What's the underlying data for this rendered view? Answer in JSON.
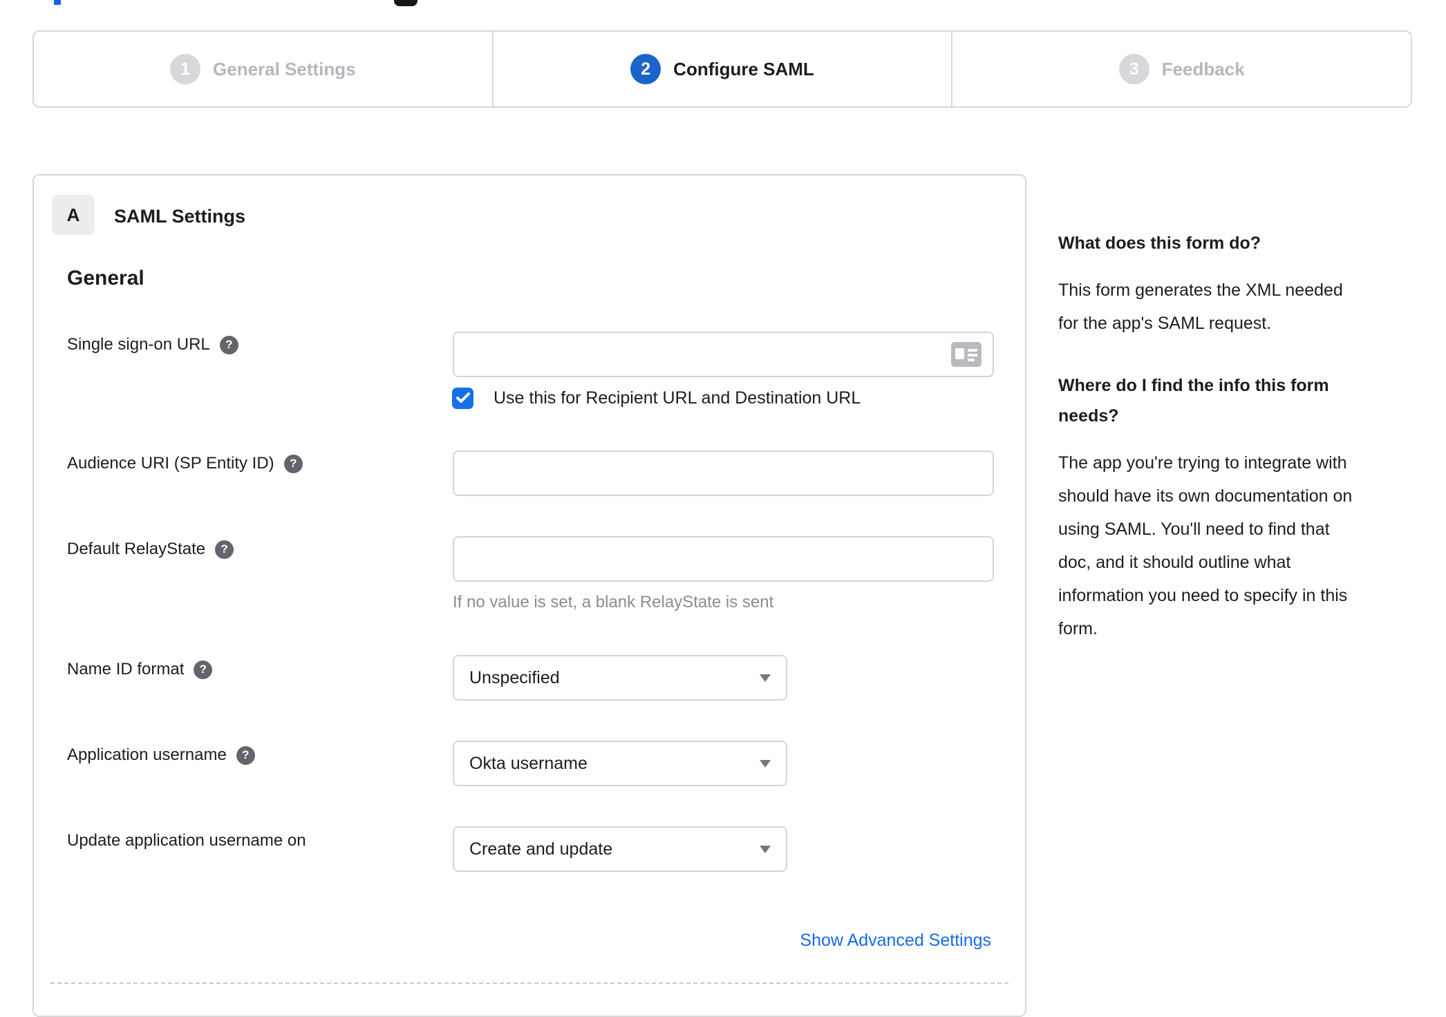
{
  "stepper": {
    "steps": [
      {
        "number": "1",
        "label": "General Settings",
        "active": false
      },
      {
        "number": "2",
        "label": "Configure SAML",
        "active": true
      },
      {
        "number": "3",
        "label": "Feedback",
        "active": false
      }
    ]
  },
  "form": {
    "badge": "A",
    "title": "SAML Settings",
    "section_heading": "General",
    "fields": [
      {
        "label": "Single sign-on URL",
        "value": "",
        "checkbox_label": "Use this for Recipient URL and Destination URL",
        "checkbox_checked": true
      },
      {
        "label": "Audience URI (SP Entity ID)",
        "value": ""
      },
      {
        "label": "Default RelayState",
        "value": "",
        "hint": "If no value is set, a blank RelayState is sent"
      },
      {
        "label": "Name ID format",
        "value": "Unspecified"
      },
      {
        "label": "Application username",
        "value": "Okta username"
      },
      {
        "label": "Update application username on",
        "value": "Create and update"
      }
    ],
    "help_icon_glyph": "?",
    "advanced_link": "Show Advanced Settings"
  },
  "sidebar": {
    "sections": [
      {
        "title_lines": [
          "What does this form do?"
        ],
        "body_lines": [
          "This form generates the XML needed",
          "for the app's SAML request."
        ]
      },
      {
        "title_lines": [
          "Where do I find the info this form",
          "needs?"
        ],
        "body_lines": [
          "The app you're trying to integrate with",
          "should have its own documentation on",
          "using SAML. You'll need to find that",
          "doc, and it should outline what",
          "information you need to specify in this",
          "form."
        ]
      }
    ]
  },
  "colors": {
    "active_step_blue": "#1b64c9",
    "checkbox_blue": "#1570e8",
    "link_blue": "#176be8",
    "border_gray": "#d8d8dd",
    "text_dark": "#1d1d21",
    "muted_text": "#8b8b93",
    "inactive_step_circle": "#d7d7dc",
    "inactive_step_label": "#b6b6bc",
    "badge_bg": "#ededef",
    "help_icon_bg": "#64646c",
    "input_icon_gray": "#b9bac0"
  }
}
